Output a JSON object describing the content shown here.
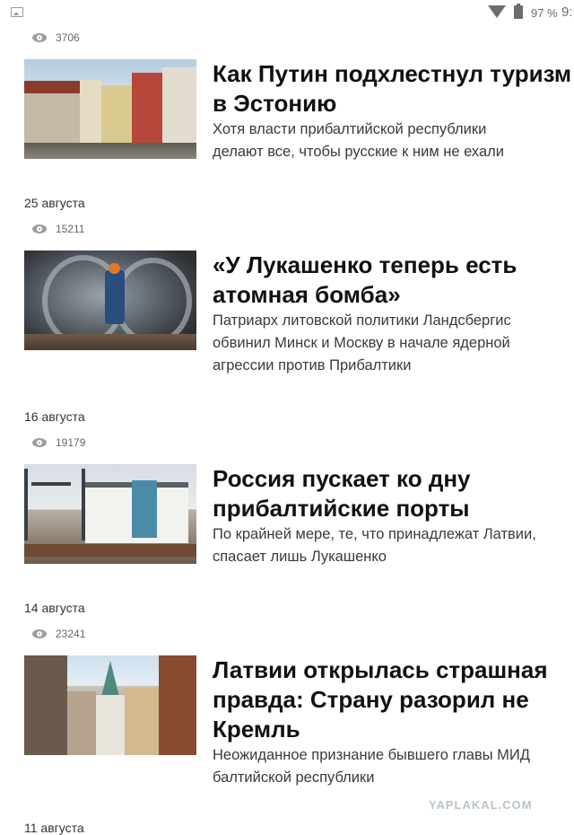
{
  "status_bar": {
    "battery_percent": "97 %",
    "time": "9:"
  },
  "articles": [
    {
      "views": "3706",
      "title_lines": [
        "Как Путин подхлестнул туризм",
        "в Эстонию"
      ],
      "lead_lines": [
        "Хотя власти прибалтийской республики",
        "делают все, чтобы русские к ним не ехали"
      ],
      "date": "25 августа"
    },
    {
      "views": "15211",
      "title_lines": [
        "«У Лукашенко теперь есть",
        "атомная бомба»"
      ],
      "lead_lines": [
        "Патриарх литовской политики Ландсбергис",
        "обвинил Минск и Москву в начале ядерной",
        "агрессии против Прибалтики"
      ],
      "date": "16 августа"
    },
    {
      "views": "19179",
      "title_lines": [
        "Россия пускает ко дну",
        "прибалтийские порты"
      ],
      "lead_lines": [
        "По крайней мере, те, что принадлежат Латвии,",
        "спасает лишь Лукашенко"
      ],
      "date": "14 августа"
    },
    {
      "views": "23241",
      "title_lines": [
        "Латвии открылась страшная",
        "правда: Страну разорил не",
        "Кремль"
      ],
      "lead_lines": [
        "Неожиданное признание бывшего главы МИД",
        "балтийской республики"
      ],
      "date": "11 августа"
    }
  ],
  "watermark": "YAPLAKAL.COM"
}
